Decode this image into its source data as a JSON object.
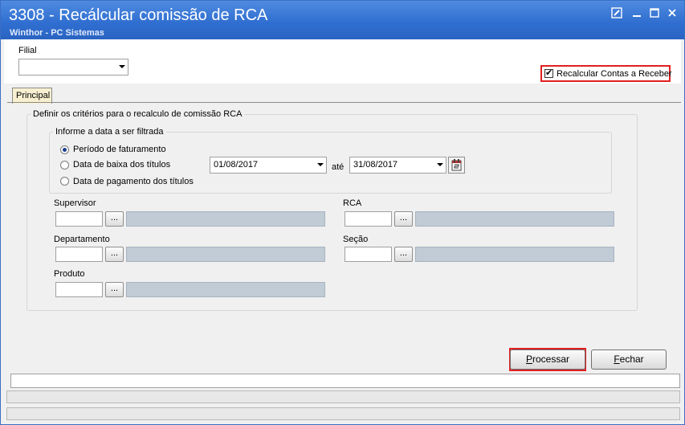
{
  "window": {
    "title": "3308 - Recálcular comissão de RCA",
    "subtitle": "Winthor - PC Sistemas"
  },
  "filial": {
    "label": "Filial",
    "value": ""
  },
  "recalcular": {
    "label": "Recalcular Contas a Receber",
    "checked": true
  },
  "tabs": [
    {
      "label": "Principal",
      "active": true
    }
  ],
  "criteria": {
    "title": "Definir os critérios para o recalculo de comissão RCA",
    "date_group_title": "Informe a data a ser filtrada",
    "options": [
      {
        "label": "Período de faturamento",
        "selected": true
      },
      {
        "label": "Data de baixa dos títulos",
        "selected": false
      },
      {
        "label": "Data de pagamento dos títulos",
        "selected": false
      }
    ],
    "date_from": "01/08/2017",
    "date_sep": "até",
    "date_to": "31/08/2017"
  },
  "fields": {
    "supervisor": {
      "label": "Supervisor",
      "lookup": "..."
    },
    "rca": {
      "label": "RCA",
      "lookup": "..."
    },
    "departamento": {
      "label": "Departamento",
      "lookup": "..."
    },
    "secao": {
      "label": "Seção",
      "lookup": "..."
    },
    "produto": {
      "label": "Produto",
      "lookup": "..."
    }
  },
  "buttons": {
    "processar_first": "P",
    "processar_rest": "rocessar",
    "fechar_first": "F",
    "fechar_rest": "echar"
  },
  "colors": {
    "titlebar": "#2f6ed0",
    "highlight": "#e02020",
    "tab_active": "#f7efcf"
  }
}
